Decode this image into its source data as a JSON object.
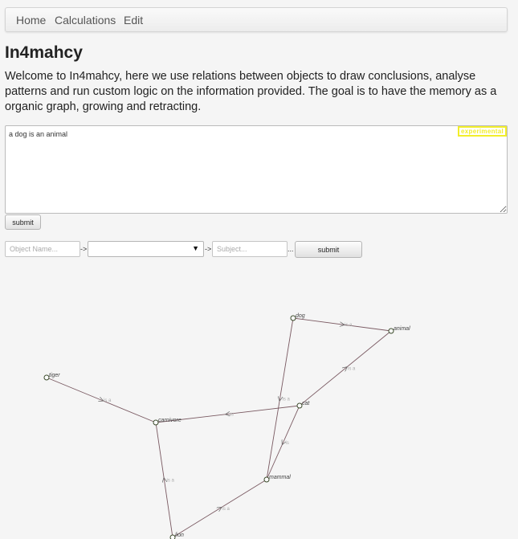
{
  "nav": {
    "items": [
      "Home",
      "Calculations",
      "Edit"
    ]
  },
  "page": {
    "title": "In4mahcy",
    "intro": "Welcome to In4mahcy, here we use relations between objects to draw conclusions, analyse patterns and run custom logic on the information provided. The goal is to have the memory as a organic graph, growing and retracting."
  },
  "input": {
    "value": "a dog is an animal",
    "badge": "experimental",
    "submit_label": "submit"
  },
  "relation_form": {
    "object_placeholder": "Object Name...",
    "arrow1": "->",
    "select_value": "",
    "arrow2": "->",
    "subject_placeholder": "Subject...",
    "ellipsis": "...",
    "submit_label": "submit"
  },
  "graph": {
    "nodes": [
      {
        "id": "dog",
        "label": "dog"
      },
      {
        "id": "animal",
        "label": "animal"
      },
      {
        "id": "tiger",
        "label": "tiger"
      },
      {
        "id": "carnivore",
        "label": "carnivore"
      },
      {
        "id": "cat",
        "label": "cat"
      },
      {
        "id": "mammal",
        "label": "mammal"
      },
      {
        "id": "lion",
        "label": "lion"
      }
    ],
    "edges": [
      {
        "from": "dog",
        "to": "animal",
        "label": "is a"
      },
      {
        "from": "dog",
        "to": "mammal",
        "label": "is a"
      },
      {
        "from": "tiger",
        "to": "carnivore",
        "label": "is a"
      },
      {
        "from": "cat",
        "to": "carnivore",
        "label": "is"
      },
      {
        "from": "cat",
        "to": "animal",
        "label": "is a"
      },
      {
        "from": "cat",
        "to": "mammal",
        "label": "is"
      },
      {
        "from": "lion",
        "to": "carnivore",
        "label": "is a"
      },
      {
        "from": "lion",
        "to": "mammal",
        "label": "is a"
      }
    ]
  }
}
